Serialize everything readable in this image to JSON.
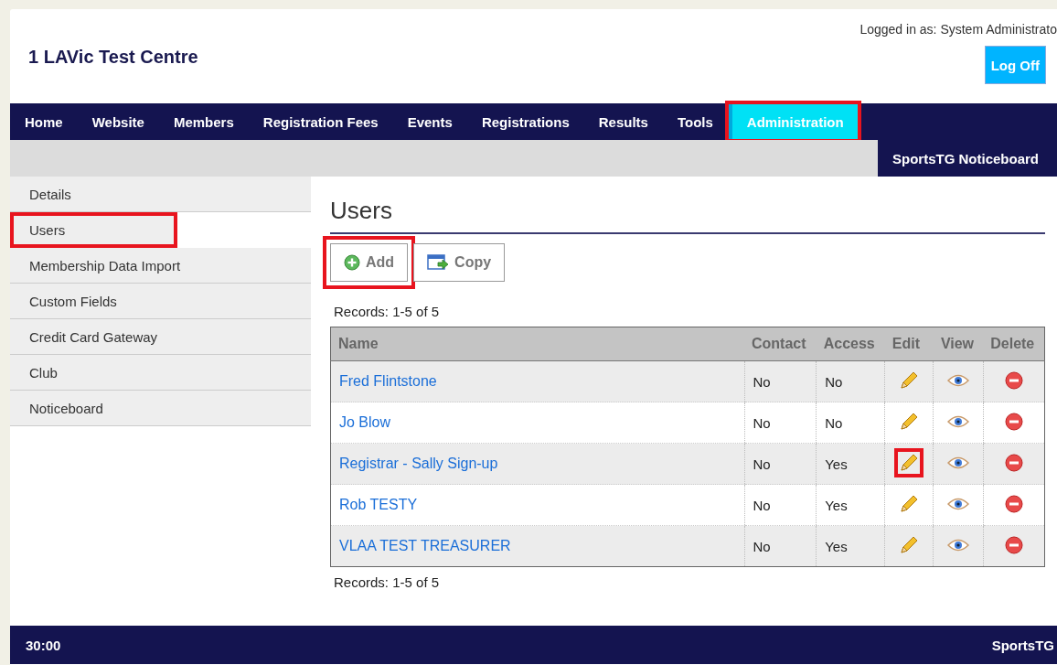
{
  "site_title": "1 LAVic Test Centre",
  "login_text": "Logged in as: System Administrato",
  "logoff_button": "Log Off",
  "nav": [
    {
      "label": "Home",
      "selected": false,
      "highlighted": false
    },
    {
      "label": "Website",
      "selected": false,
      "highlighted": false
    },
    {
      "label": "Members",
      "selected": false,
      "highlighted": false
    },
    {
      "label": "Registration Fees",
      "selected": false,
      "highlighted": false
    },
    {
      "label": "Events",
      "selected": false,
      "highlighted": false
    },
    {
      "label": "Registrations",
      "selected": false,
      "highlighted": false
    },
    {
      "label": "Results",
      "selected": false,
      "highlighted": false
    },
    {
      "label": "Tools",
      "selected": false,
      "highlighted": false
    },
    {
      "label": "Administration",
      "selected": true,
      "highlighted": true
    }
  ],
  "subnav_link": "SportsTG Noticeboard",
  "sidebar": [
    {
      "label": "Details",
      "highlighted": false
    },
    {
      "label": "Users",
      "highlighted": true
    },
    {
      "label": "Membership Data Import",
      "highlighted": false
    },
    {
      "label": "Custom Fields",
      "highlighted": false
    },
    {
      "label": "Credit Card Gateway",
      "highlighted": false
    },
    {
      "label": "Club",
      "highlighted": false
    },
    {
      "label": "Noticeboard",
      "highlighted": false
    }
  ],
  "heading": "Users",
  "buttons": [
    {
      "kind": "add",
      "label": "Add",
      "highlighted": true
    },
    {
      "kind": "copy",
      "label": "Copy",
      "highlighted": false
    }
  ],
  "records_top": "Records: 1-5 of 5",
  "table": {
    "columns": [
      "Name",
      "Contact",
      "Access",
      "Edit",
      "View",
      "Delete"
    ],
    "rows": [
      {
        "name": "Fred Flintstone",
        "contact": "No",
        "access": "No",
        "edit_highlighted": false
      },
      {
        "name": "Jo Blow",
        "contact": "No",
        "access": "No",
        "edit_highlighted": false
      },
      {
        "name": "Registrar - Sally Sign-up",
        "contact": "No",
        "access": "Yes",
        "edit_highlighted": true
      },
      {
        "name": "Rob TESTY",
        "contact": "No",
        "access": "Yes",
        "edit_highlighted": false
      },
      {
        "name": "VLAA TEST TREASURER",
        "contact": "No",
        "access": "Yes",
        "edit_highlighted": false
      }
    ]
  },
  "records_bottom": "Records: 1-5 of 5",
  "footer": {
    "timer": "30:00",
    "brand": "SportsTG"
  }
}
